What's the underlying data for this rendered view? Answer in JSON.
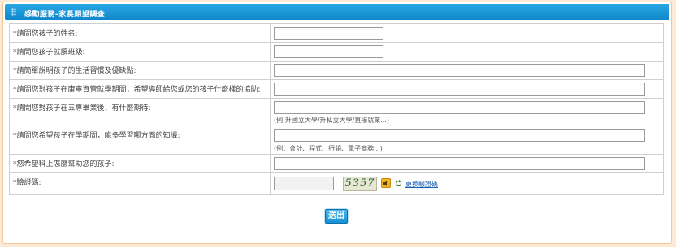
{
  "title": "感動服務-家長期望調查",
  "rows": [
    {
      "label": "*請問您孩子的姓名:"
    },
    {
      "label": "*請問您孩子就讀班級:"
    },
    {
      "label": "*請簡單說明孩子的生活習慣及優缺點:"
    },
    {
      "label": "*請問您對孩子在康寧資管就學期間，希望導師給您或您的孩子什麼樣的協助:"
    },
    {
      "label": "*請問您對孩子在五專畢業後，有什麼期待:",
      "hint": "(例:升國立大學/升私立大學/直接就業...)"
    },
    {
      "label": "*請問您希望孩子在學期間，能多學習哪方面的知識:",
      "hint": "(例：會計、程式、行銷、電子商務...)"
    },
    {
      "label": "*您希望科上怎麼幫助您的孩子:"
    },
    {
      "label": "*驗證碼:"
    }
  ],
  "captcha": {
    "code": "5357",
    "refresh_label": "更換驗證碼"
  },
  "submit_label": "送出",
  "colors": {
    "titlebar": "#1a93d6",
    "page_bg": "#fde9d4",
    "panel_border": "#f2c79a"
  }
}
